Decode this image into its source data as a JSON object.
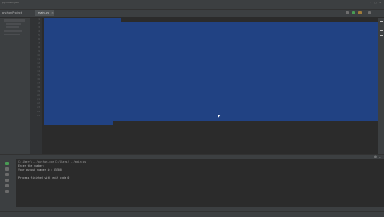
{
  "window": {
    "title": "pythonProject"
  },
  "menu": [],
  "project_tab": "pythonProject",
  "editor_tab": {
    "label": "main.py"
  },
  "project_tree": [],
  "line_numbers": [
    "1",
    "2",
    "3",
    "4",
    "5",
    "6",
    "7",
    "8",
    "9",
    "10",
    "11",
    "12",
    "13",
    "14",
    "15",
    "16",
    "17",
    "18",
    "19",
    "20",
    "21",
    "22",
    "23",
    "24",
    "25"
  ],
  "code_lines": [
    "",
    "",
    "",
    "",
    "",
    "",
    "",
    "",
    "",
    "",
    "",
    "",
    "",
    "",
    "",
    "",
    "",
    "",
    "",
    "",
    "",
    "",
    "",
    "",
    ""
  ],
  "console": {
    "lines": [
      "C:\\Users\\...\\python.exe C:/Users/.../main.py",
      "Enter the number:",
      "Your output number is: 55500",
      "",
      "Process finished with exit code 0"
    ]
  },
  "status_bar": {
    "right": ""
  }
}
